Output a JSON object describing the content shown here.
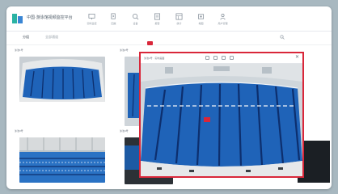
{
  "header": {
    "title": "中国·游泳馆视频监控平台",
    "nav": [
      {
        "label": "实时监控",
        "icon": "monitor-icon"
      },
      {
        "label": "回放",
        "icon": "playback-icon"
      },
      {
        "label": "设备",
        "icon": "device-icon"
      },
      {
        "label": "报警",
        "icon": "alarm-icon"
      },
      {
        "label": "统计",
        "icon": "stats-icon"
      },
      {
        "label": "地图",
        "icon": "map-icon"
      },
      {
        "label": "用户管理",
        "icon": "user-icon"
      }
    ]
  },
  "toolbar": {
    "tabs": [
      "分组",
      "全部通道"
    ]
  },
  "cameras": [
    {
      "label": "泳池1号"
    },
    {
      "label": "泳池2号"
    },
    {
      "label": "泳池3号"
    },
    {
      "label": "泳池4号"
    }
  ],
  "popup": {
    "badge": "",
    "title": "泳池2号 · 实时画面",
    "close": "✕"
  },
  "colors": {
    "accent": "#d9273a",
    "pool_blue": "#1f63b8",
    "lane": "#0d2f6e"
  }
}
